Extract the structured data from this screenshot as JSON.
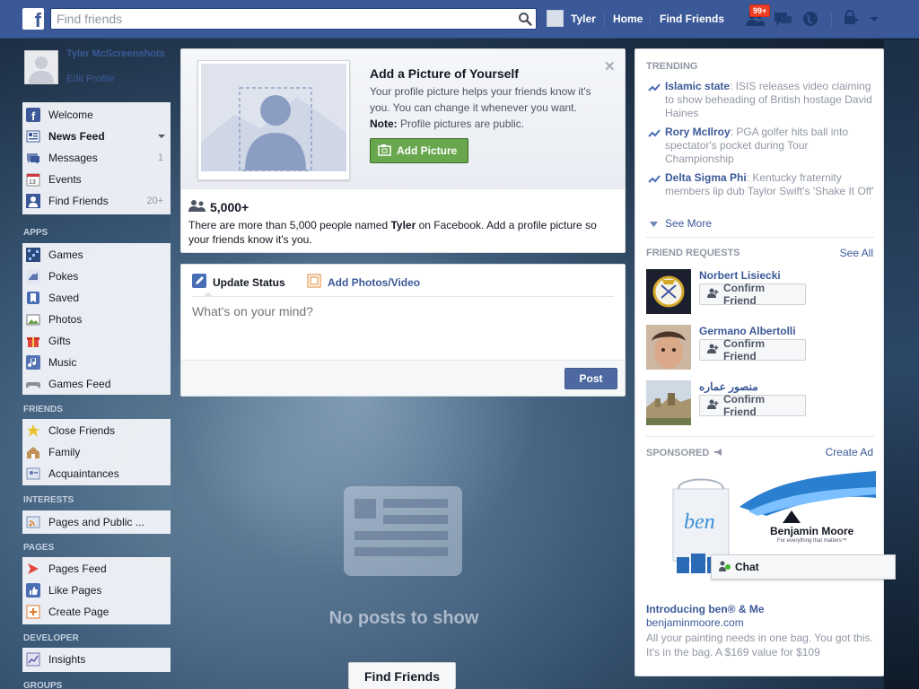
{
  "topbar": {
    "logo": "f",
    "search_placeholder": "Find friends",
    "user_name": "Tyler",
    "home_label": "Home",
    "find_friends_label": "Find Friends",
    "friend_request_badge": "99+"
  },
  "sidebar": {
    "profile_name": "Tyler McScreenshots",
    "edit_profile": "Edit Profile",
    "favorites": [
      {
        "label": "Welcome",
        "icon": "facebook-icon",
        "count": ""
      },
      {
        "label": "News Feed",
        "icon": "news-feed-icon",
        "count": ""
      },
      {
        "label": "Messages",
        "icon": "messages-icon",
        "count": "1"
      },
      {
        "label": "Events",
        "icon": "calendar-icon",
        "count": ""
      },
      {
        "label": "Find Friends",
        "icon": "find-friends-icon",
        "count": "20+"
      }
    ],
    "apps_header": "APPS",
    "apps": [
      {
        "label": "Games",
        "icon": "games-icon"
      },
      {
        "label": "Pokes",
        "icon": "pokes-icon"
      },
      {
        "label": "Saved",
        "icon": "saved-icon"
      },
      {
        "label": "Photos",
        "icon": "photos-icon"
      },
      {
        "label": "Gifts",
        "icon": "gifts-icon"
      },
      {
        "label": "Music",
        "icon": "music-icon"
      },
      {
        "label": "Games Feed",
        "icon": "games-feed-icon"
      }
    ],
    "friends_header": "FRIENDS",
    "friends": [
      {
        "label": "Close Friends",
        "icon": "star-icon"
      },
      {
        "label": "Family",
        "icon": "family-icon"
      },
      {
        "label": "Acquaintances",
        "icon": "acquaintances-icon"
      }
    ],
    "interests_header": "INTERESTS",
    "interests": [
      {
        "label": "Pages and Public ...",
        "icon": "rss-icon"
      }
    ],
    "pages_header": "PAGES",
    "pages": [
      {
        "label": "Pages Feed",
        "icon": "pages-feed-icon"
      },
      {
        "label": "Like Pages",
        "icon": "like-icon"
      },
      {
        "label": "Create Page",
        "icon": "create-page-icon"
      }
    ],
    "developer_header": "DEVELOPER",
    "developer": [
      {
        "label": "Insights",
        "icon": "insights-icon"
      }
    ],
    "groups_header": "GROUPS"
  },
  "profile_card": {
    "title": "Add a Picture of Yourself",
    "body": "Your profile picture helps your friends know it's you. You can change it whenever you want.",
    "note_label": "Note:",
    "note_text": " Profile pictures are public.",
    "add_picture_button": "Add Picture",
    "people_count": "5,000+",
    "people_text_1": "There are more than 5,000 people named ",
    "people_name": "Tyler",
    "people_text_2": " on Facebook. Add a profile picture so your friends know it's you."
  },
  "composer": {
    "tab_update_status": "Update Status",
    "tab_add_photos": "Add Photos/Video",
    "placeholder": "What's on your mind?",
    "post_button": "Post"
  },
  "feed": {
    "empty_text": "No posts to show",
    "find_friends_button": "Find Friends"
  },
  "trending": {
    "header": "TRENDING",
    "items": [
      {
        "topic": "Islamic state",
        "text": ": ISIS releases video claiming to show beheading of British hostage David Haines"
      },
      {
        "topic": "Rory McIlroy",
        "text": ": PGA golfer hits ball into spectator's pocket during Tour Championship"
      },
      {
        "topic": "Delta Sigma Phi",
        "text": ": Kentucky fraternity members lip dub Taylor Swift's 'Shake It Off'"
      }
    ],
    "see_more": "See More"
  },
  "friend_requests": {
    "header": "FRIEND REQUESTS",
    "see_all": "See All",
    "items": [
      {
        "name": "Norbert Lisiecki",
        "button": "Confirm Friend"
      },
      {
        "name": "Germano Albertolli",
        "button": "Confirm Friend"
      },
      {
        "name": "منصور عماره",
        "button": "Confirm Friend"
      }
    ]
  },
  "sponsored": {
    "header": "SPONSORED",
    "create_ad": "Create Ad",
    "ad_logo_script": "ben",
    "ad_brand": "Benjamin Moore",
    "ad_tagline": "For everything that matters™",
    "ad_title": "Introducing ben® & Me",
    "ad_url": "benjaminmoore.com",
    "ad_text": "All your painting needs in one bag. You got this. It's in the bag. A $169 value for $109"
  },
  "chat": {
    "label": "Chat"
  },
  "colors": {
    "brand_blue": "#3b5998",
    "green_button": "#69a74e",
    "badge_red": "#f03d25"
  }
}
